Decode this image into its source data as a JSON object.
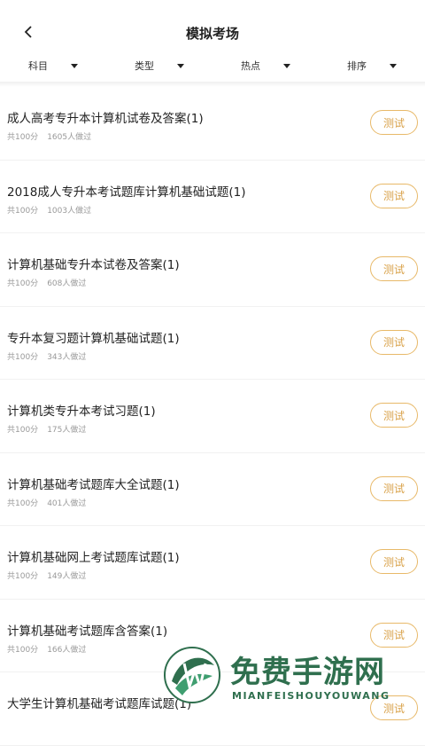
{
  "header": {
    "title": "模拟考场"
  },
  "filters": [
    {
      "label": "科目"
    },
    {
      "label": "类型"
    },
    {
      "label": "热点"
    },
    {
      "label": "排序"
    }
  ],
  "items": [
    {
      "title": "成人高考专升本计算机试卷及答案(1)",
      "score": "共100分",
      "count": "1605人做过",
      "button": "测试"
    },
    {
      "title": "2018成人专升本考试题库计算机基础试题(1)",
      "score": "共100分",
      "count": "1003人做过",
      "button": "测试"
    },
    {
      "title": "计算机基础专升本试卷及答案(1)",
      "score": "共100分",
      "count": "608人做过",
      "button": "测试"
    },
    {
      "title": "专升本复习题计算机基础试题(1)",
      "score": "共100分",
      "count": "343人做过",
      "button": "测试"
    },
    {
      "title": "计算机类专升本考试习题(1)",
      "score": "共100分",
      "count": "175人做过",
      "button": "测试"
    },
    {
      "title": "计算机基础考试题库大全试题(1)",
      "score": "共100分",
      "count": "401人做过",
      "button": "测试"
    },
    {
      "title": "计算机基础网上考试题库试题(1)",
      "score": "共100分",
      "count": "149人做过",
      "button": "测试"
    },
    {
      "title": "计算机基础考试题库含答案(1)",
      "score": "共100分",
      "count": "166人做过",
      "button": "测试"
    },
    {
      "title": "大学生计算机基础考试题库试题(1)",
      "score": "",
      "count": "",
      "button": "测试"
    }
  ],
  "watermark": {
    "cn": "免费手游网",
    "en": "MIANFEISHOUYOUWANG"
  },
  "colors": {
    "accent": "#d9a24a",
    "accent_border": "#e8b969",
    "watermark": "#2f6f4e"
  }
}
